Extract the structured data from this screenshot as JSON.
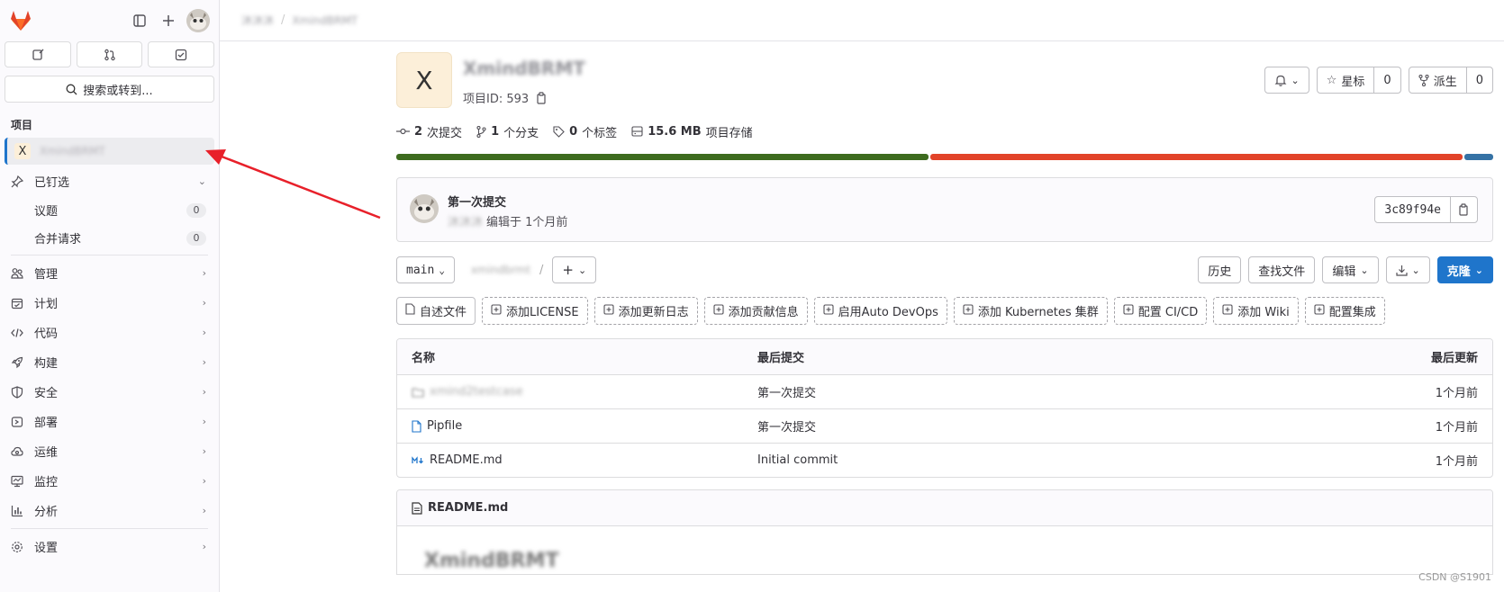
{
  "sidebar": {
    "search_label": "搜索或转到...",
    "section_title": "项目",
    "project_letter": "X",
    "project_name": "XmindBRMT",
    "pinned": {
      "label": "已钉选",
      "items": [
        {
          "label": "议题",
          "count": "0"
        },
        {
          "label": "合并请求",
          "count": "0"
        }
      ]
    },
    "nav": [
      {
        "icon": "users-icon",
        "label": "管理"
      },
      {
        "icon": "calendar-icon",
        "label": "计划"
      },
      {
        "icon": "code-icon",
        "label": "代码"
      },
      {
        "icon": "rocket-icon",
        "label": "构建"
      },
      {
        "icon": "shield-icon",
        "label": "安全"
      },
      {
        "icon": "deploy-icon",
        "label": "部署"
      },
      {
        "icon": "cloud-gear-icon",
        "label": "运维"
      },
      {
        "icon": "monitor-icon",
        "label": "监控"
      },
      {
        "icon": "chart-icon",
        "label": "分析"
      }
    ],
    "settings_label": "设置"
  },
  "breadcrumb": {
    "group": "沐沐沐",
    "project": "XmindBRMT"
  },
  "project": {
    "letter": "X",
    "title": "XmindBRMT",
    "id_text": "项目ID: 593"
  },
  "header_buttons": {
    "star_label": "星标",
    "star_count": "0",
    "fork_label": "派生",
    "fork_count": "0"
  },
  "stats": {
    "commits_num": "2",
    "commits_label": "次提交",
    "branches_num": "1",
    "branches_label": "个分支",
    "tags_num": "0",
    "tags_label": "个标签",
    "storage_num": "15.6 MB",
    "storage_label": "项目存储"
  },
  "language_bar": [
    {
      "color": "#3d6b1f",
      "share": 40.5
    },
    {
      "color": "#e24329",
      "share": 40.5
    },
    {
      "color": "#3572a5",
      "share": 2.2
    }
  ],
  "last_commit": {
    "title": "第一次提交",
    "author": "沐沐沐",
    "meta": "编辑于 1个月前",
    "sha": "3c89f94e"
  },
  "toolbar": {
    "branch": "main",
    "path": "xmindbrmt",
    "path_sep": "/",
    "history": "历史",
    "find_file": "查找文件",
    "edit": "编辑",
    "clone": "克隆"
  },
  "quick_actions": [
    {
      "label": "自述文件",
      "solid": true
    },
    {
      "label": "添加LICENSE"
    },
    {
      "label": "添加更新日志"
    },
    {
      "label": "添加贡献信息"
    },
    {
      "label": "启用Auto DevOps"
    },
    {
      "label": "添加 Kubernetes 集群"
    },
    {
      "label": "配置 CI/CD"
    },
    {
      "label": "添加 Wiki"
    },
    {
      "label": "配置集成"
    }
  ],
  "files": {
    "headers": {
      "name": "名称",
      "commit": "最后提交",
      "updated": "最后更新"
    },
    "rows": [
      {
        "name": "xmind2testcase",
        "commit": "第一次提交",
        "updated": "1个月前",
        "blurred": true
      },
      {
        "name": "Pipfile",
        "commit": "第一次提交",
        "updated": "1个月前"
      },
      {
        "name": "README.md",
        "commit": "Initial commit",
        "updated": "1个月前"
      }
    ]
  },
  "readme": {
    "filename": "README.md",
    "heading": "XmindBRMT"
  },
  "watermark": "CSDN @S1901"
}
